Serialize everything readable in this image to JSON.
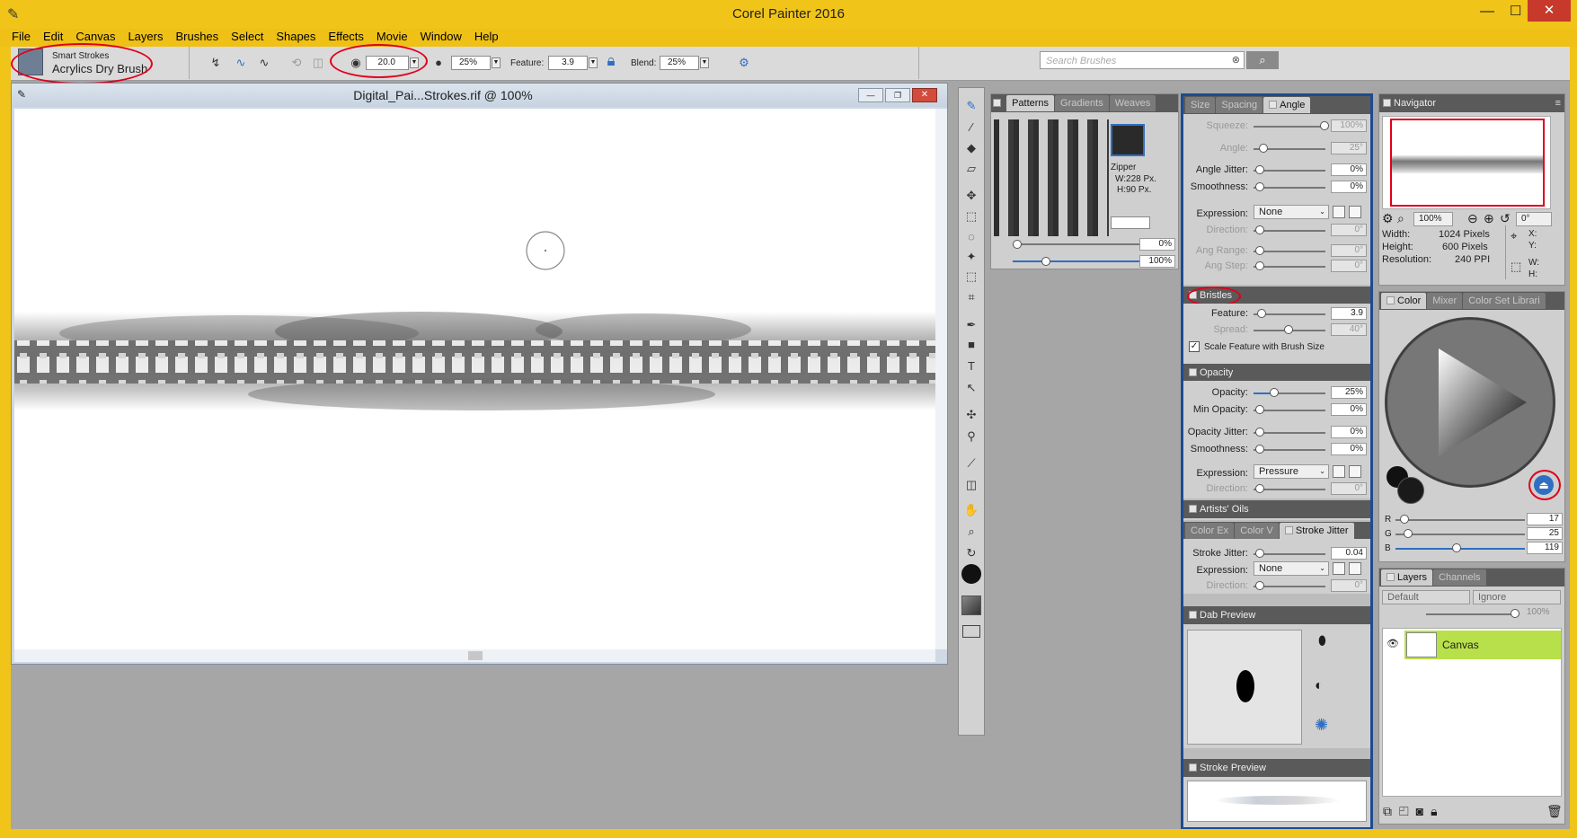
{
  "app": {
    "title": "Corel Painter 2016"
  },
  "menu": [
    "File",
    "Edit",
    "Canvas",
    "Layers",
    "Brushes",
    "Select",
    "Shapes",
    "Effects",
    "Movie",
    "Window",
    "Help"
  ],
  "propbar": {
    "category": "Smart Strokes",
    "variant": "Acrylics Dry Brush",
    "size": "20.0",
    "opacity": "25%",
    "feature_label": "Feature:",
    "feature": "3.9",
    "blend_label": "Blend:",
    "blend": "25%",
    "search_placeholder": "Search Brushes"
  },
  "document": {
    "title": "Digital_Pai...Strokes.rif @ 100%"
  },
  "patterns": {
    "tabs": [
      "Patterns",
      "Gradients",
      "Weaves"
    ],
    "name": "Zipper",
    "width": "W:228 Px.",
    "height": "H:90 Px.",
    "v1": "0%",
    "v2": "100%"
  },
  "angle_panel": {
    "tabs": [
      "Size",
      "Spacing",
      "Angle"
    ],
    "squeeze_label": "Squeeze:",
    "squeeze": "100%",
    "angle_label": "Angle:",
    "angle": "25°",
    "jitter_label": "Angle Jitter:",
    "jitter": "0%",
    "smooth_label": "Smoothness:",
    "smooth": "0%",
    "expr_label": "Expression:",
    "expr": "None",
    "dir_label": "Direction:",
    "dir": "0°",
    "range_label": "Ang Range:",
    "range": "0°",
    "step_label": "Ang Step:",
    "step": "0°"
  },
  "bristles": {
    "title": "Bristles",
    "feature_label": "Feature:",
    "feature": "3.9",
    "spread_label": "Spread:",
    "spread": "40°",
    "scale_label": "Scale Feature with Brush Size"
  },
  "opacity_panel": {
    "title": "Opacity",
    "op_label": "Opacity:",
    "op": "25%",
    "min_label": "Min Opacity:",
    "min": "0%",
    "jit_label": "Opacity Jitter:",
    "jit": "0%",
    "sm_label": "Smoothness:",
    "sm": "0%",
    "expr_label": "Expression:",
    "expr": "Pressure",
    "dir_label": "Direction:",
    "dir": "0°"
  },
  "artists_oils": {
    "title": "Artists' Oils"
  },
  "stroke_jitter": {
    "tabs": [
      "Color Ex",
      "Color V",
      "Stroke Jitter"
    ],
    "sj_label": "Stroke Jitter:",
    "sj": "0.04",
    "expr_label": "Expression:",
    "expr": "None",
    "dir_label": "Direction:",
    "dir": "0°"
  },
  "dab_preview": {
    "title": "Dab Preview"
  },
  "stroke_preview": {
    "title": "Stroke Preview"
  },
  "navigator": {
    "title": "Navigator",
    "zoom": "100%",
    "rotation": "0°",
    "width_label": "Width:",
    "width": "1024 Pixels",
    "height_label": "Height:",
    "height": "600 Pixels",
    "res_label": "Resolution:",
    "res": "240 PPI",
    "x_label": "X:",
    "y_label": "Y:",
    "w_label": "W:",
    "h_label": "H:"
  },
  "color": {
    "tabs": [
      "Color",
      "Mixer",
      "Color Set Librari"
    ],
    "r_label": "R",
    "r": "17",
    "g_label": "G",
    "g": "25",
    "b_label": "B",
    "b": "119",
    "r_pct": 0.07,
    "g_pct": 0.1,
    "b_pct": 0.47
  },
  "layers": {
    "tabs": [
      "Layers",
      "Channels"
    ],
    "composite": "Default",
    "method": "Ignore",
    "opacity": "100%",
    "layer_name": "Canvas"
  },
  "colors": {
    "accent_yellow": "#f0c419",
    "panel_blue": "#1d4b91",
    "highlight_red": "#e0001a",
    "layer_green": "#b8e04a"
  }
}
